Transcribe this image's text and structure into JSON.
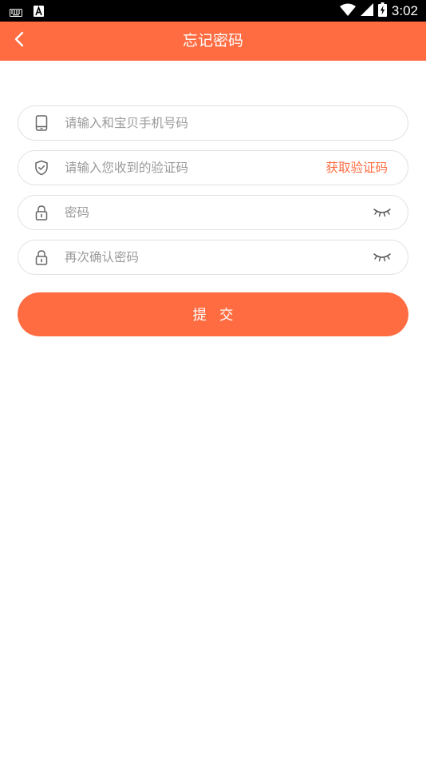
{
  "status_bar": {
    "time": "3:02",
    "icons": [
      "keyboard-icon",
      "a-notification-icon",
      "wifi-icon",
      "signal-icon",
      "battery-charging-icon"
    ]
  },
  "header": {
    "title": "忘记密码",
    "back_icon": "chevron-left-icon"
  },
  "form": {
    "phone": {
      "placeholder": "请输入和宝贝手机号码",
      "icon": "phone-icon"
    },
    "code": {
      "placeholder": "请输入您收到的验证码",
      "icon": "shield-icon",
      "get_code_label": "获取验证码"
    },
    "password": {
      "placeholder": "密码",
      "icon": "lock-icon",
      "toggle_icon": "eye-closed-icon"
    },
    "confirm_password": {
      "placeholder": "再次确认密码",
      "icon": "lock-icon",
      "toggle_icon": "eye-closed-icon"
    },
    "submit_label": "提交"
  },
  "colors": {
    "accent": "#ff6c41",
    "border": "#e1e1e1",
    "placeholder": "#9a9a9a",
    "icon": "#666666"
  }
}
